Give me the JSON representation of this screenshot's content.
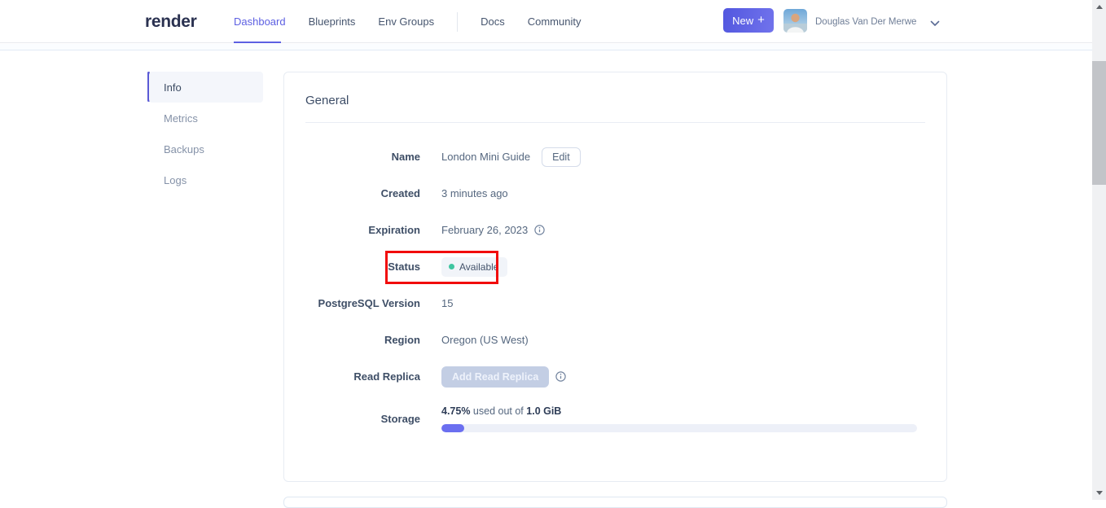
{
  "header": {
    "logo": "render",
    "nav": [
      {
        "label": "Dashboard",
        "active": true
      },
      {
        "label": "Blueprints"
      },
      {
        "label": "Env Groups"
      },
      {
        "label": "Docs"
      },
      {
        "label": "Community"
      }
    ],
    "new_button": {
      "label": "New",
      "plus": "+"
    },
    "user": {
      "name": "Douglas Van Der Merwe"
    }
  },
  "sidebar": {
    "items": [
      {
        "label": "Info",
        "active": true
      },
      {
        "label": "Metrics"
      },
      {
        "label": "Backups"
      },
      {
        "label": "Logs"
      }
    ]
  },
  "general": {
    "title": "General",
    "name": {
      "label": "Name",
      "value": "London Mini Guide",
      "edit_label": "Edit"
    },
    "created": {
      "label": "Created",
      "value": "3 minutes ago"
    },
    "expiration": {
      "label": "Expiration",
      "value": "February 26, 2023"
    },
    "status": {
      "label": "Status",
      "value": "Available"
    },
    "version": {
      "label": "PostgreSQL Version",
      "value": "15"
    },
    "region": {
      "label": "Region",
      "value": "Oregon (US West)"
    },
    "read_replica": {
      "label": "Read Replica",
      "button_label": "Add Read Replica"
    },
    "storage": {
      "label": "Storage",
      "used_pct": "4.75%",
      "middle_text": " used out of ",
      "total": "1.0 GiB",
      "progress_pct": 4.75
    }
  },
  "colors": {
    "brand_purple": "#5d60e2",
    "status_dot_green": "#3ec5a0",
    "annotation_red": "#f10c0c",
    "progress_fill": "#6b6ff0"
  }
}
